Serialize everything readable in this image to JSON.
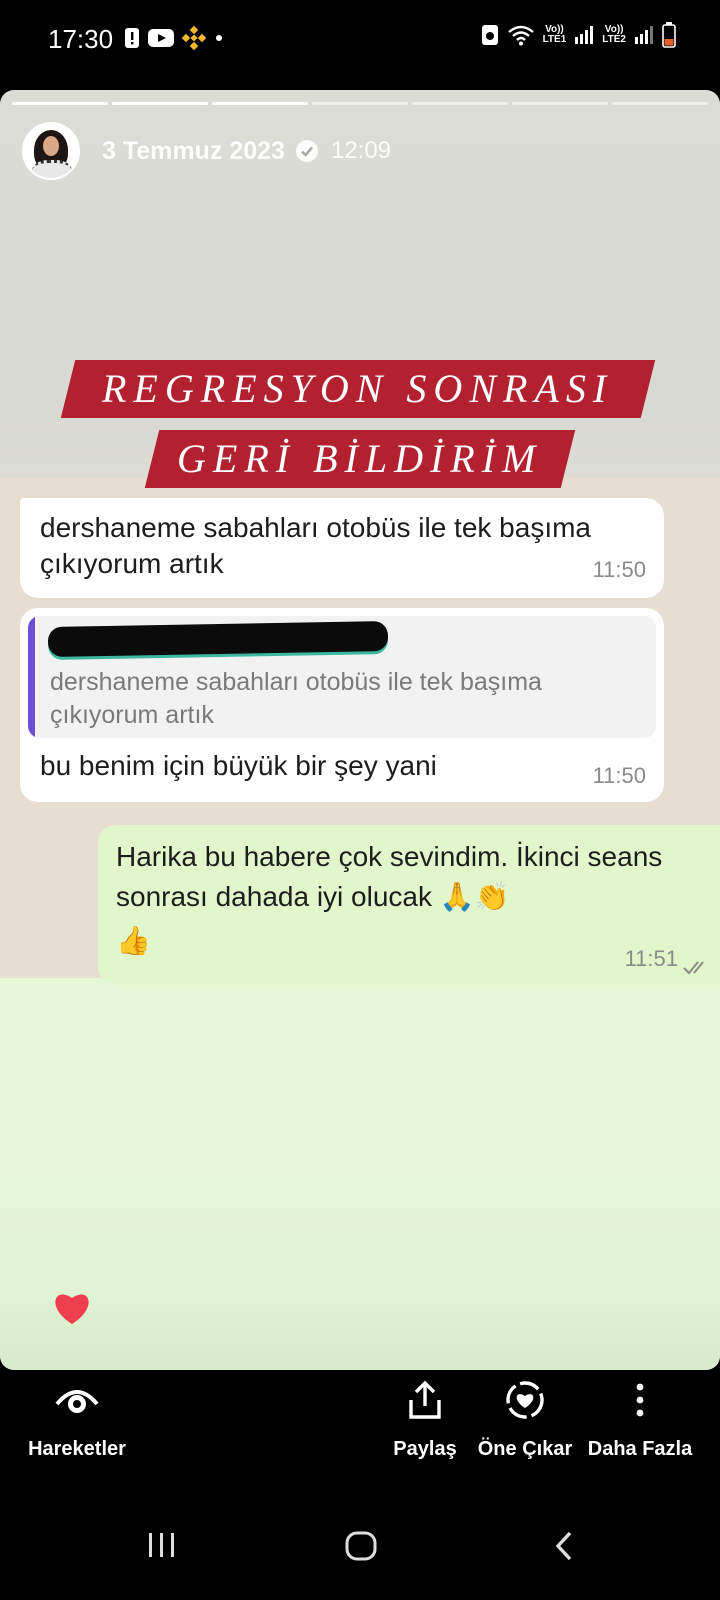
{
  "status_bar": {
    "time": "17:30",
    "left_icons": [
      "alert-icon",
      "youtube-icon",
      "binance-icon",
      "dot-icon"
    ],
    "right_icons": [
      "sim-icon",
      "wifi-icon",
      "volte-lte1-icon",
      "signal-icon",
      "volte-lte2-icon",
      "signal-icon",
      "battery-icon"
    ],
    "lte1_top": "Vo))",
    "lte1_bottom": "LTE1",
    "lte2_top": "Vo))",
    "lte2_bottom": "LTE2"
  },
  "story": {
    "progress_segments": 7,
    "progress_current": 4,
    "date": "3 Temmuz 2023",
    "time": "12:09",
    "title_line1": "REGRESYON SONRASI",
    "title_line2": "GERİ BİLDİRİM",
    "banner_color": "#b32131"
  },
  "chat": {
    "messages": [
      {
        "direction": "incoming",
        "text": "dershaneme sabahları otobüs ile tek başıma çıkıyorum artık",
        "time": "11:50"
      },
      {
        "direction": "incoming",
        "quoted_text": "dershaneme sabahları otobüs ile tek başıma çıkıyorum artık",
        "text": "bu benim için büyük bir şey yani",
        "time": "11:50"
      },
      {
        "direction": "outgoing",
        "text": "Harika bu habere çok sevindim. İkinci seans sonrası dahada iyi olucak 🙏👏",
        "emoji_line": "👍",
        "time": "11:51",
        "status_icon": "double-check-icon"
      }
    ]
  },
  "like_icon": "heart-icon",
  "actions": [
    {
      "label": "Hareketler",
      "icon": "activity-eye-icon"
    },
    {
      "label": "Paylaş",
      "icon": "share-icon"
    },
    {
      "label": "Öne Çıkar",
      "icon": "highlight-heart-icon"
    },
    {
      "label": "Daha Fazla",
      "icon": "more-vertical-icon"
    }
  ],
  "nav": [
    "recent-apps-icon",
    "home-icon",
    "back-icon"
  ]
}
